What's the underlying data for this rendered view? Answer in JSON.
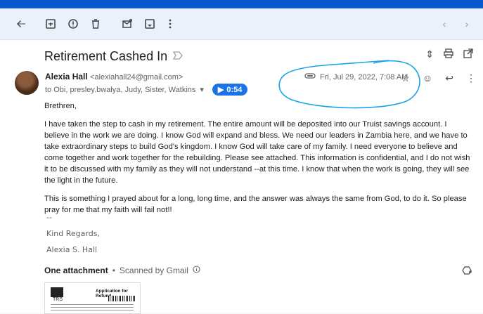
{
  "toolbar": {
    "icons": [
      "back-arrow-icon",
      "archive-icon",
      "report-spam-icon",
      "delete-icon",
      "mark-unread-icon",
      "snooze-icon",
      "more-icon"
    ],
    "nav": [
      "chevron-left-icon",
      "chevron-right-icon"
    ]
  },
  "message": {
    "subject": "Retirement Cashed In",
    "sender_name": "Alexia Hall",
    "sender_email": "<alexiahall24@gmail.com>",
    "to_line": "to Obi, presley.bwalya, Judy, Sister, Watkins",
    "audio_duration": "0:54",
    "date": "Fri, Jul 29, 2022, 7:08 AM",
    "greeting": "Brethren,",
    "paragraph1": "I have taken the step to cash in my retirement. The entire amount will be deposited into our Truist savings account. I believe in the work we are doing. I know God will expand and bless. We need our leaders in Zambia here, and we have to take extraordinary steps to build God's kingdom. I know God will take care of my family. I need everyone to believe and come together and work together for the rebuilding. Please see attached. This information is confidential, and I do not wish it to be discussed with my family as they will not understand --at this time. I know that when the work is going, they will see the light in the future.",
    "paragraph2": "This is something I prayed about for a long, long time, and the answer was always the same from God, to do it. So please pray for me that my faith will fail not!!",
    "signature_dashes": "--",
    "signature_closing": "Kind Regards,",
    "signature_name": "Alexia S. Hall"
  },
  "attachments": {
    "heading": "One attachment",
    "separator": "•",
    "scanned": "Scanned by Gmail",
    "file": {
      "logo_text": "TRS",
      "title": "Application for Refund"
    }
  },
  "colors": {
    "accent": "#1a73e8",
    "annotation": "#1aa3e8"
  }
}
